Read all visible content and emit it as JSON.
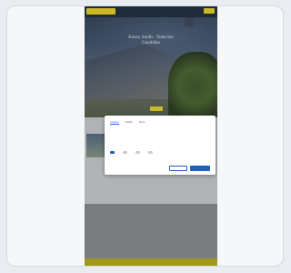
{
  "screen": {
    "hero": {
      "title_lines": [
        "Kenny Smith · Team Inn",
        "Geraldine"
      ]
    },
    "modal": {
      "tabs": [
        "Consent",
        "Details",
        "About"
      ]
    }
  },
  "colors": {
    "accent": "#e7d32b",
    "header_bg": "#243241",
    "footer_bg": "#b7ad21",
    "modal_accent": "#1f5fbf"
  }
}
